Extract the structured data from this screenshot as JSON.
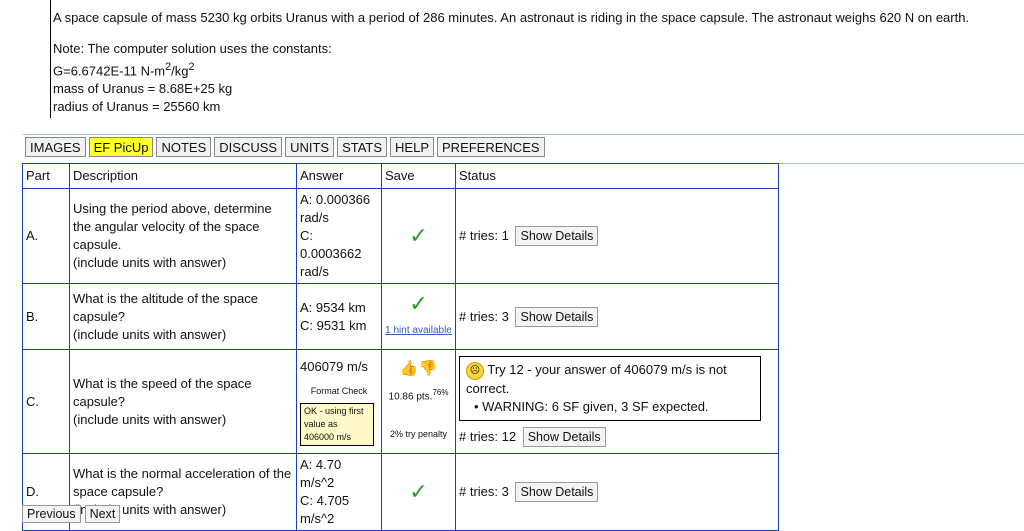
{
  "problem": {
    "statement": "A space capsule of mass 5230 kg orbits Uranus with a period of 286 minutes. An astronaut is riding in the space capsule. The astronaut weighs 620 N on earth.",
    "note_heading": "Note: The computer solution uses the constants:",
    "constant_g_prefix": "G=6.6742E-11 N-m",
    "constant_g_sup1": "2",
    "constant_g_mid": "/kg",
    "constant_g_sup2": "2",
    "mass_line": "mass of Uranus = 8.68E+25 kg",
    "radius_line": "radius of Uranus = 25560 km"
  },
  "toolbar": {
    "tabs": [
      "IMAGES",
      "EF PicUp",
      "NOTES",
      "DISCUSS",
      "UNITS",
      "STATS",
      "HELP",
      "PREFERENCES"
    ]
  },
  "table": {
    "headers": {
      "part": "Part",
      "description": "Description",
      "answer": "Answer",
      "save": "Save",
      "status": "Status"
    },
    "rows": [
      {
        "part": "A.",
        "desc1": "Using the period above, determine the angular velocity of the space capsule.",
        "desc2": "(include units with answer)",
        "answer_a": "A: 0.000366 rad/s",
        "answer_c": "C: 0.0003662 rad/s",
        "tries_label": "# tries: 1",
        "details": "Show Details"
      },
      {
        "part": "B.",
        "desc1": "What is the altitude of the space capsule?",
        "desc2": "(include units with answer)",
        "answer_a": "A: 9534 km",
        "answer_c": "C: 9531 km",
        "hint": "1 hint available",
        "tries_label": "# tries: 3",
        "details": "Show Details"
      },
      {
        "part": "C.",
        "desc1": "What is the speed of the space capsule?",
        "desc2": "(include units with answer)",
        "input_value": "406079 m/s",
        "format_check_title": "Format Check",
        "format_check_body": "OK - using first value as 406000 m/s",
        "points": "10.86 pts.",
        "points_sup": "76%",
        "penalty": "2% try penalty",
        "feedback_main": "Try 12 - your answer of 406079 m/s is not correct.",
        "feedback_warning": "WARNING: 6 SF given, 3 SF expected.",
        "tries_label": "# tries: 12",
        "details": "Show Details"
      },
      {
        "part": "D.",
        "desc1": "What is the normal acceleration of the space capsule?",
        "desc2": "(include units with answer)",
        "answer_a": "A: 4.70 m/s^2",
        "answer_c": "C: 4.705 m/s^2",
        "tries_label": "# tries: 3",
        "details": "Show Details"
      }
    ]
  },
  "nav": {
    "previous": "Previous",
    "next": "Next"
  },
  "colors": {
    "table_border": "#1a3bbd",
    "highlight_tab": "#ffff33",
    "check_green": "#2a9a2a"
  }
}
